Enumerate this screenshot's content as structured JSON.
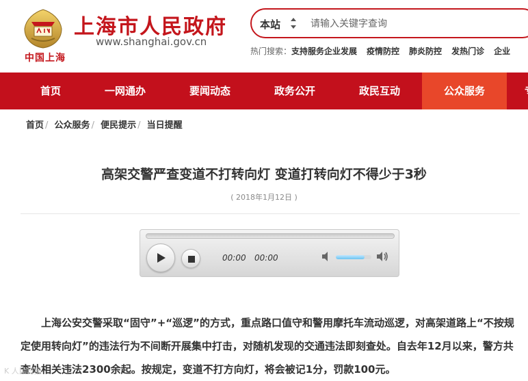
{
  "header": {
    "site_title": "上海市人民政府",
    "site_url": "www.shanghai.gov.cn",
    "logo_sub": "中国上海",
    "brand_color": "#c4161c"
  },
  "search": {
    "scope": "本站",
    "placeholder": "请输入关键字查询",
    "hot_label": "热门搜索：",
    "hot_items": [
      "支持服务企业发展",
      "疫情防控",
      "肺炎防控",
      "发热门诊",
      "企业"
    ]
  },
  "nav": {
    "items": [
      "首页",
      "一网通办",
      "要闻动态",
      "政务公开",
      "政民互动",
      "公众服务",
      "专"
    ],
    "active_index": 5,
    "bg_color": "#c3101c",
    "active_color": "#e8472a"
  },
  "breadcrumb": [
    "首页",
    "公众服务",
    "便民提示",
    "当日提醒"
  ],
  "article": {
    "title": "高架交警严查变道不打转向灯 变道打转向灯不得少于3秒",
    "date": "( 2018年1月12日 )",
    "body": "上海公安交警采取“固守”+“巡逻”的方式，重点路口值守和警用摩托车流动巡逻，对高架道路上“不按规定使用转向灯”的违法行为不间断开展集中打击，对随机发现的交通违法即刻查处。自去年12月以来，警方共查处相关违法2300余起。按规定，变道不打方向灯，将会被记1分，罚款100元。"
  },
  "player": {
    "current_time": "00:00",
    "duration": "00:00",
    "volume": 0.8,
    "progress": 0
  },
  "watermark": "K 人民日报"
}
